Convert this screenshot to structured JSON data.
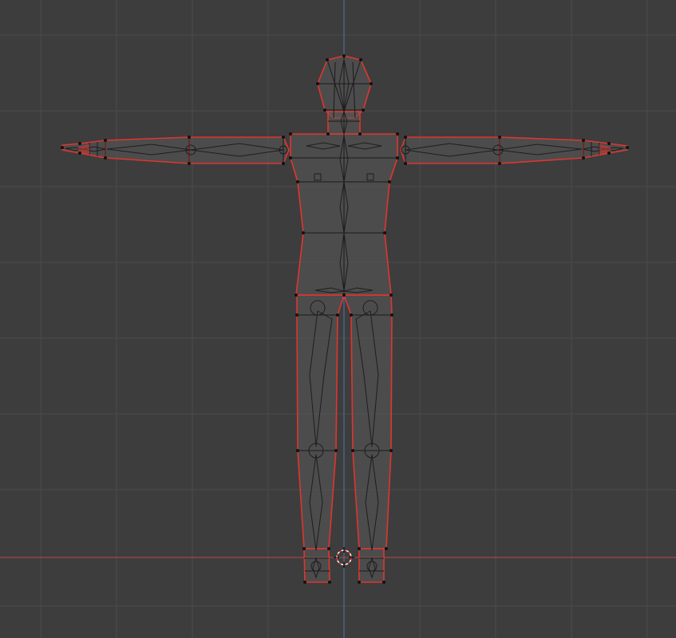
{
  "viewport": {
    "background": "#3d3d3d",
    "grid_color": "#4a4a4a",
    "x_axis_color": "#c0484e",
    "y_axis_color": "#4a78b0",
    "mesh_outline_color": "#e0352f",
    "object": "t-pose-humanoid-mesh-with-armature",
    "view": "front-orthographic",
    "cursor": "3d-cursor-icon"
  }
}
